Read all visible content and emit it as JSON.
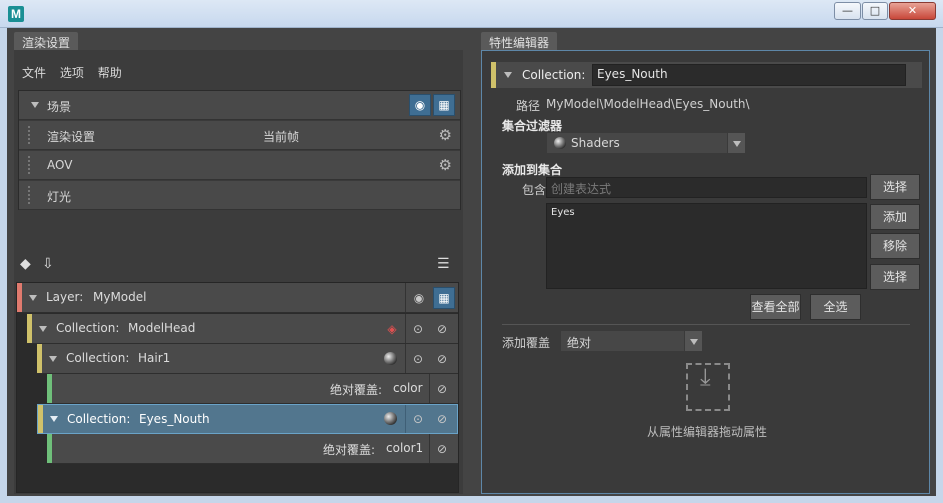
{
  "window": {
    "logo": "M",
    "min": "—",
    "max": "□",
    "close": "✕"
  },
  "left_tab": "渲染设置",
  "right_tab": "特性编辑器",
  "menu": [
    "文件",
    "选项",
    "帮助"
  ],
  "scene_rows": [
    {
      "label": "场景"
    },
    {
      "label": "渲染设置",
      "value": "当前帧"
    },
    {
      "label": "AOV"
    },
    {
      "label": "灯光"
    }
  ],
  "tree": {
    "layer": {
      "label": "Layer:",
      "name": "MyModel",
      "color": "#e07a6e"
    },
    "collection1": {
      "label": "Collection:",
      "name": "ModelHead",
      "color": "#cfc16a"
    },
    "collection2": {
      "label": "Collection:",
      "name": "Hair1",
      "color": "#cfc16a"
    },
    "override1": {
      "label": "绝对覆盖:",
      "name": "color",
      "color": "#6fbf7a"
    },
    "collection3": {
      "label": "Collection:",
      "name": "Eyes_Nouth",
      "color": "#cfc16a"
    },
    "override2": {
      "label": "绝对覆盖:",
      "name": "color1",
      "color": "#6fbf7a"
    }
  },
  "editor": {
    "collection_label": "Collection:",
    "collection_name": "Eyes_Nouth",
    "path_label": "路径",
    "path_value": "MyModel\\ModelHead\\Eyes_Nouth\\",
    "filter_heading": "集合过滤器",
    "filter_value": "Shaders",
    "add_heading": "添加到集合",
    "include_label": "包含",
    "include_placeholder": "创建表达式",
    "list_items": [
      "Eyes"
    ],
    "btn_select1": "选择",
    "btn_add": "添加",
    "btn_remove": "移除",
    "btn_select2": "选择",
    "btn_view_all": "查看全部",
    "btn_select_all": "全选",
    "override_label": "添加覆盖",
    "override_value": "绝对",
    "drag_hint": "从属性编辑器拖动属性"
  },
  "colors": {
    "accent": "#3f6e93",
    "selection": "#52768e"
  }
}
